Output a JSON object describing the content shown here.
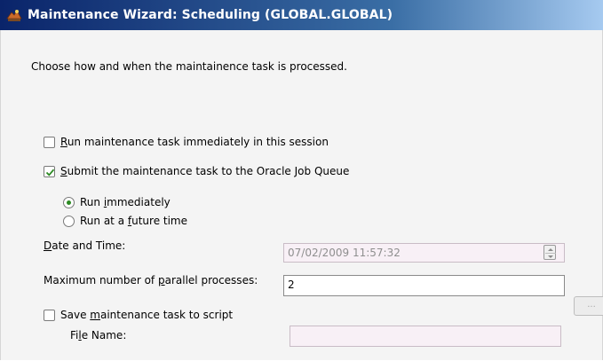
{
  "window": {
    "title": "Maintenance Wizard: Scheduling (GLOBAL.GLOBAL)",
    "icon": "maintenance-wizard-icon"
  },
  "intro_text": "Choose how and when the maintainence task is processed.",
  "options": {
    "run_immediately_session": {
      "pre": "",
      "key": "R",
      "post": "un maintenance task immediately in this session",
      "checked": false
    },
    "submit_job_queue": {
      "pre": "",
      "key": "S",
      "post": "ubmit the maintenance task to the Oracle Job Queue",
      "checked": true
    },
    "radio_run_immediately": {
      "pre": "Run ",
      "key": "i",
      "post": "mmediately",
      "selected": true
    },
    "radio_run_future": {
      "pre": "Run at a ",
      "key": "f",
      "post": "uture time",
      "selected": false
    }
  },
  "date_time": {
    "label_pre": "",
    "label_key": "D",
    "label_post": "ate and Time:",
    "value": "07/02/2009 11:57:32"
  },
  "parallel": {
    "label_pre": "Maximum number of ",
    "label_key": "p",
    "label_post": "arallel processes:",
    "value": "2"
  },
  "save_script": {
    "pre": "Save ",
    "key": "m",
    "post": "aintenance task to script",
    "checked": false
  },
  "file_name": {
    "label_pre": "Fi",
    "label_key": "l",
    "label_post": "e Name:",
    "value": "",
    "browse_label": "..."
  },
  "colors": {
    "radio_selected": "#2b8a22",
    "check_mark": "#2b8a22",
    "disabled_field_bg": "#f8f0f6"
  }
}
